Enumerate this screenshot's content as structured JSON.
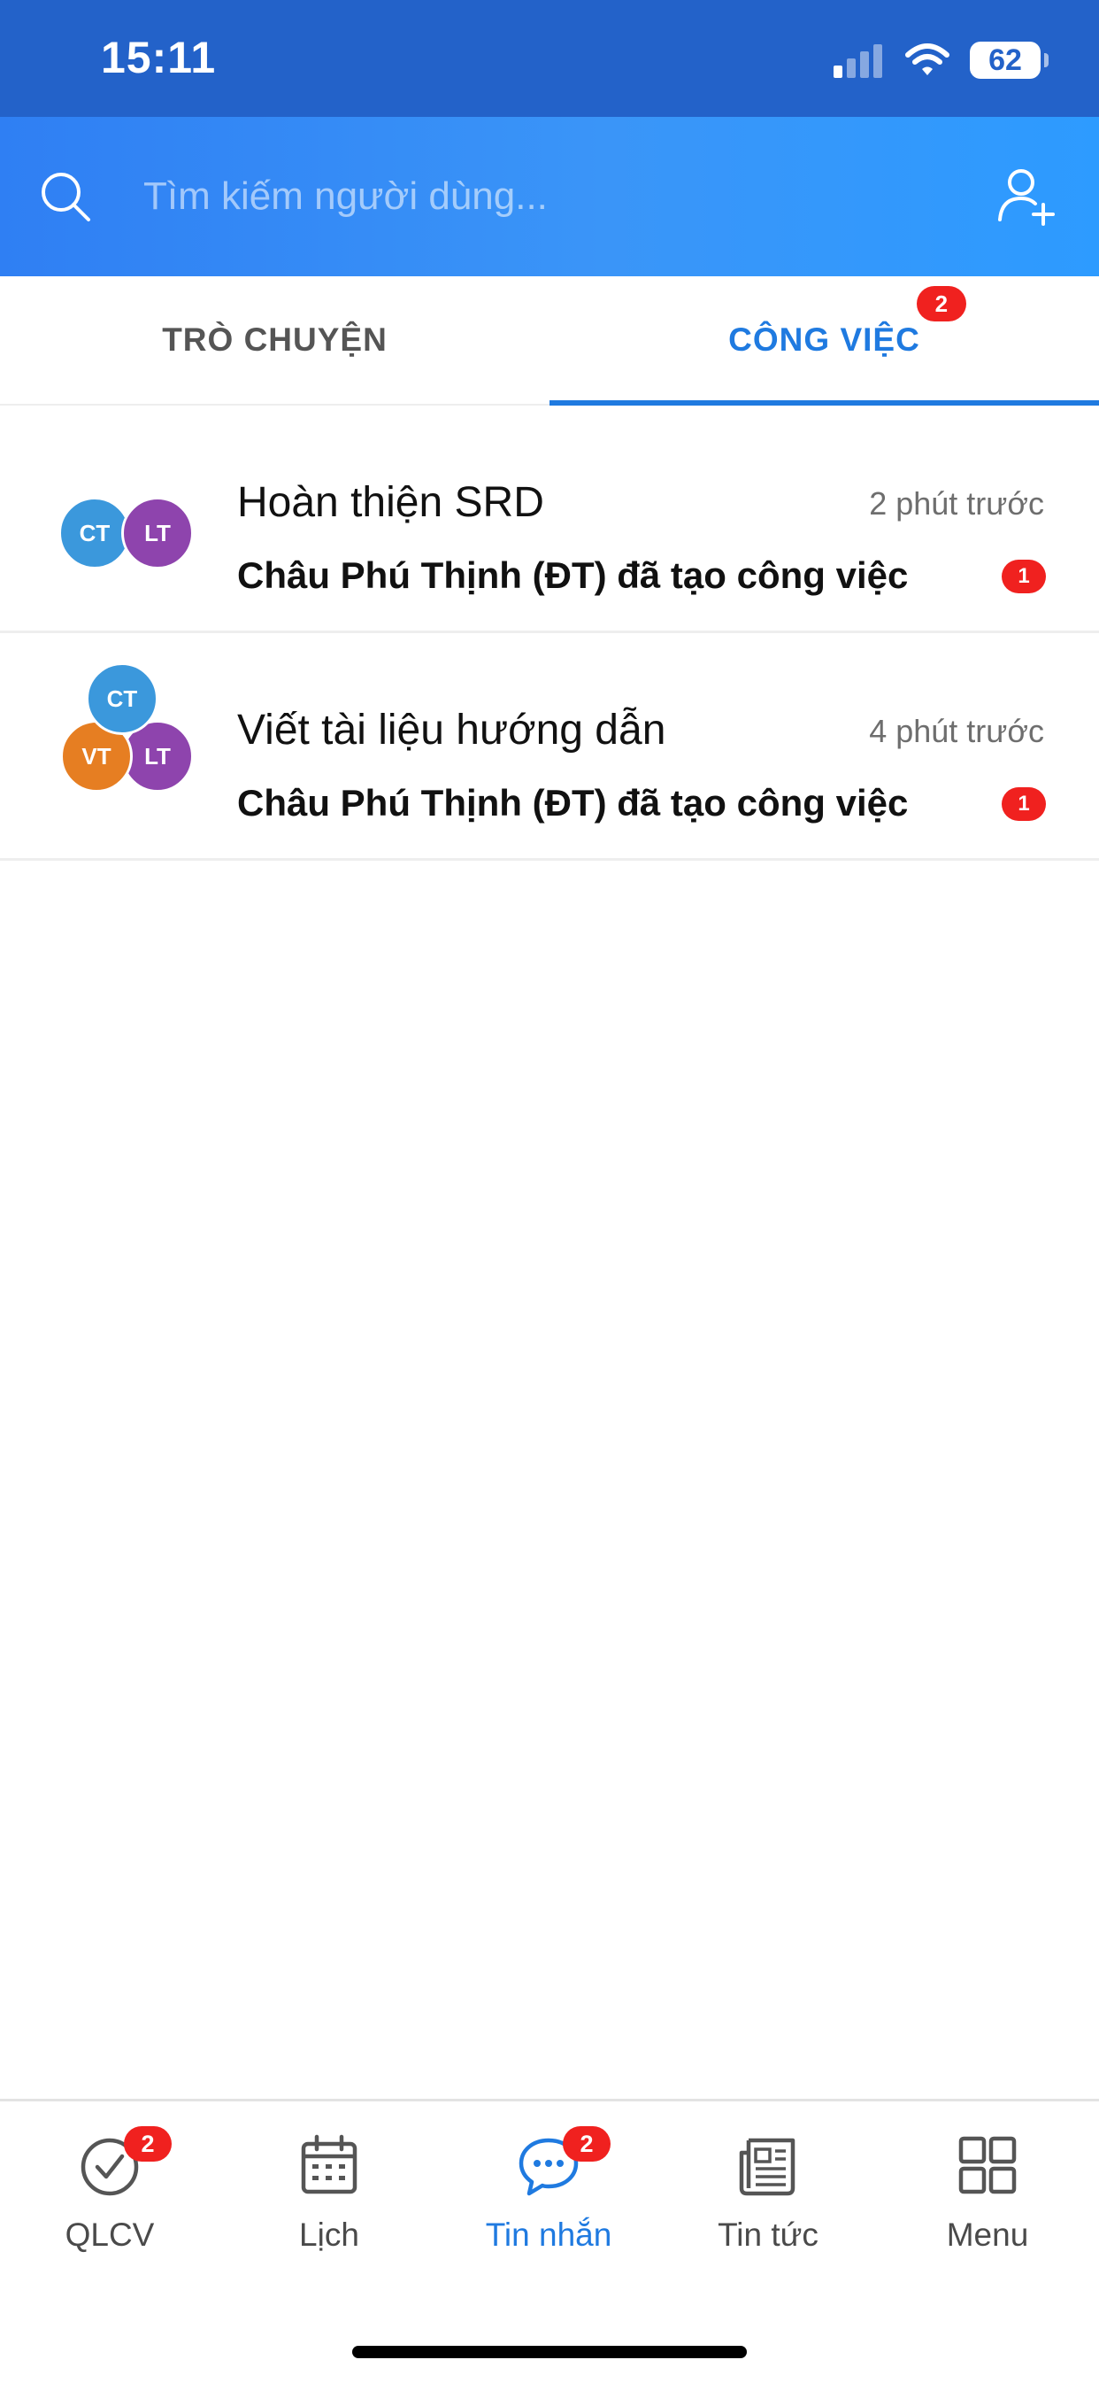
{
  "status_bar": {
    "time": "15:11",
    "battery": "62"
  },
  "search": {
    "placeholder": "Tìm kiếm người dùng..."
  },
  "tabs": [
    {
      "label": "TRÒ CHUYỆN",
      "active": false
    },
    {
      "label": "CÔNG VIỆC",
      "active": true,
      "badge": "2"
    }
  ],
  "tasks": [
    {
      "title": "Hoàn thiện SRD",
      "time": "2 phút trước",
      "subtitle": "Châu Phú Thịnh (ĐT) đã tạo công việc",
      "badge": "1",
      "avatars": [
        {
          "initials": "CT",
          "color": "#3b98dc"
        },
        {
          "initials": "LT",
          "color": "#8e44ad"
        }
      ]
    },
    {
      "title": "Viết tài liệu hướng dẫn",
      "time": "4 phút trước",
      "subtitle": "Châu Phú Thịnh (ĐT) đã tạo công việc",
      "badge": "1",
      "avatars": [
        {
          "initials": "CT",
          "color": "#3b98dc"
        },
        {
          "initials": "VT",
          "color": "#e67e22"
        },
        {
          "initials": "LT",
          "color": "#8e44ad"
        }
      ]
    }
  ],
  "bottom_nav": [
    {
      "label": "QLCV",
      "icon": "check-circle-icon",
      "badge": "2"
    },
    {
      "label": "Lịch",
      "icon": "calendar-icon"
    },
    {
      "label": "Tin nhắn",
      "icon": "chat-bubble-icon",
      "badge": "2",
      "active": true
    },
    {
      "label": "Tin tức",
      "icon": "newspaper-icon"
    },
    {
      "label": "Menu",
      "icon": "grid-icon"
    }
  ],
  "colors": {
    "status_bar": "#2362c9",
    "header_gradient_start": "#2f7ff3",
    "header_gradient_end": "#2d9bff",
    "accent": "#1f7ae0",
    "badge": "#f0211f"
  }
}
